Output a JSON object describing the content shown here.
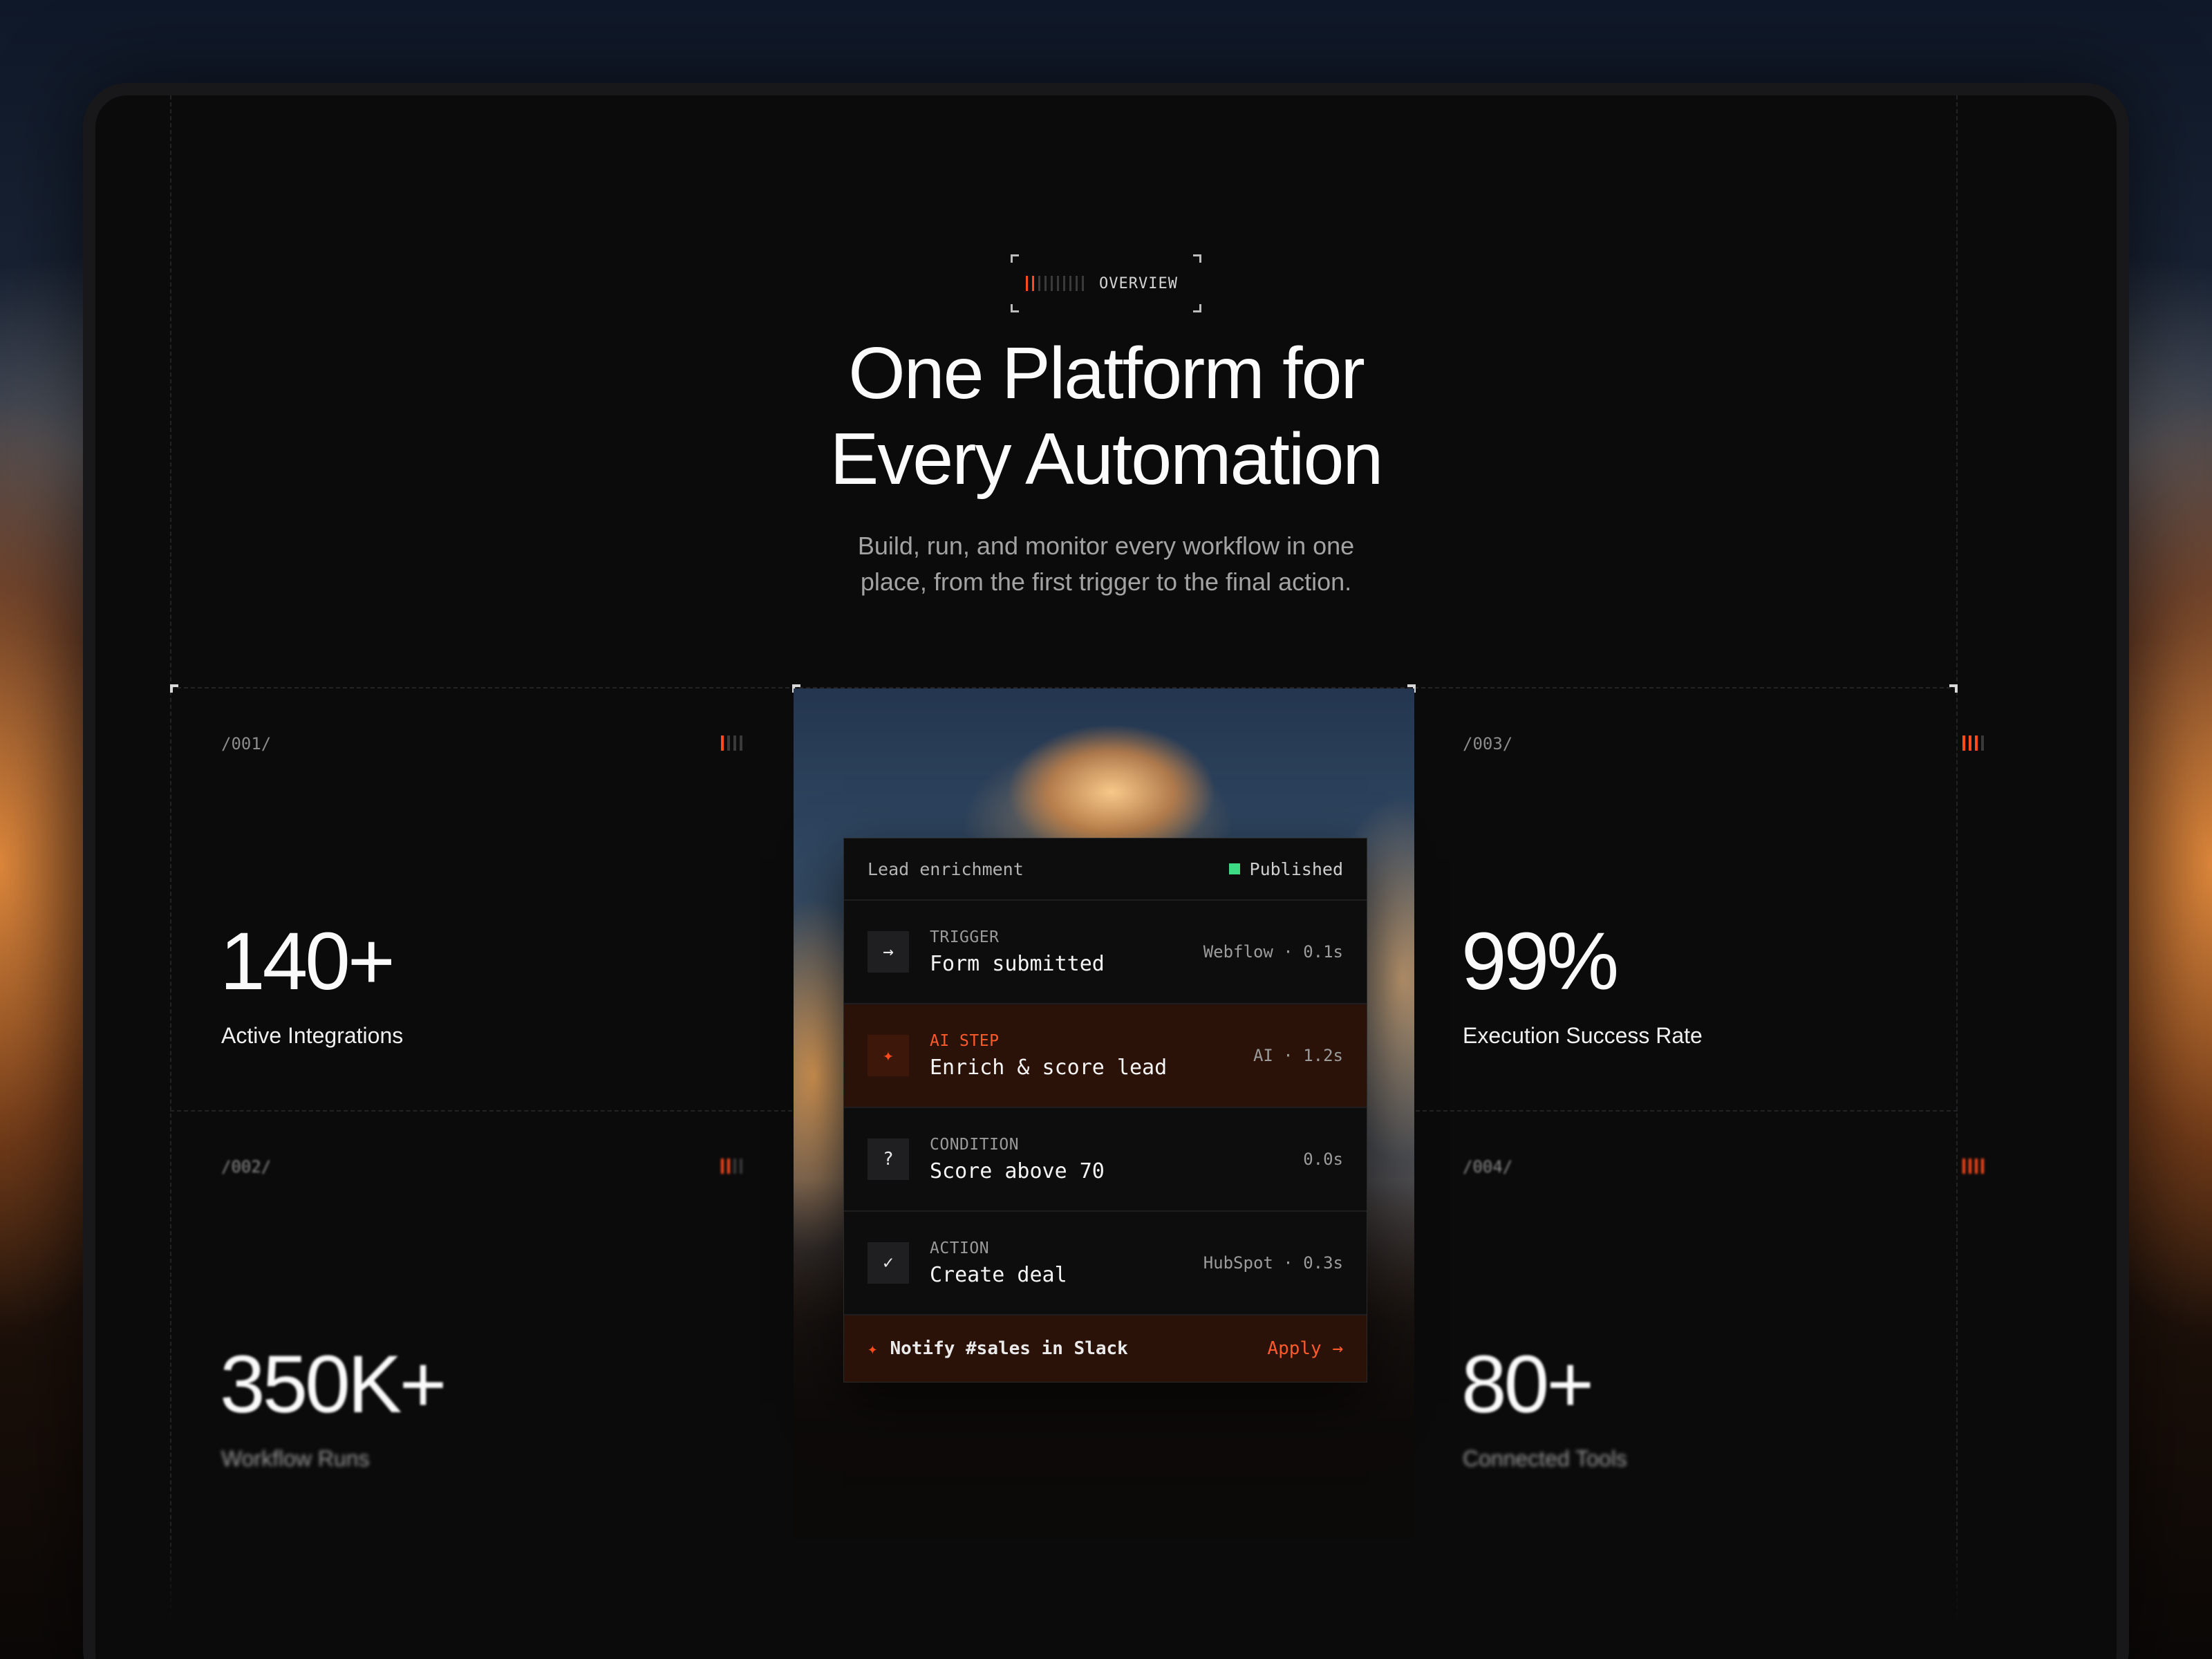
{
  "badge": {
    "label": "OVERVIEW"
  },
  "hero": {
    "title_line1": "One Platform for",
    "title_line2": "Every Automation",
    "subtitle_line1": "Build, run, and monitor every workflow in one",
    "subtitle_line2": "place, from the first trigger to the final action."
  },
  "stats": [
    {
      "id": "/001/",
      "value": "140+",
      "label": "Active Integrations",
      "level": 1
    },
    {
      "id": "/002/",
      "value": "350K+",
      "label": "Workflow Runs",
      "level": 2
    },
    {
      "id": "/003/",
      "value": "99%",
      "label": "Execution Success Rate",
      "level": 3
    },
    {
      "id": "/004/",
      "value": "80+",
      "label": "Connected Tools",
      "level": 4
    }
  ],
  "workflow": {
    "title": "Lead enrichment",
    "status": "Published",
    "status_color": "#3ddc84",
    "steps": [
      {
        "kind": "TRIGGER",
        "name": "Form submitted",
        "meta": "Webflow · 0.1s",
        "icon": "arrow-right-icon"
      },
      {
        "kind": "AI STEP",
        "name": "Enrich & score lead",
        "meta": "AI · 1.2s",
        "icon": "sparkle-icon"
      },
      {
        "kind": "CONDITION",
        "name": "Score above 70",
        "meta": "0.0s",
        "icon": "question-icon"
      },
      {
        "kind": "ACTION",
        "name": "Create deal",
        "meta": "HubSpot · 0.3s",
        "icon": "check-icon"
      }
    ],
    "suggestion": {
      "text": "Notify #sales in Slack",
      "action": "Apply →"
    }
  },
  "colors": {
    "accent": "#ff4a1c",
    "background": "#0b0b0c",
    "success": "#3ddc84"
  }
}
